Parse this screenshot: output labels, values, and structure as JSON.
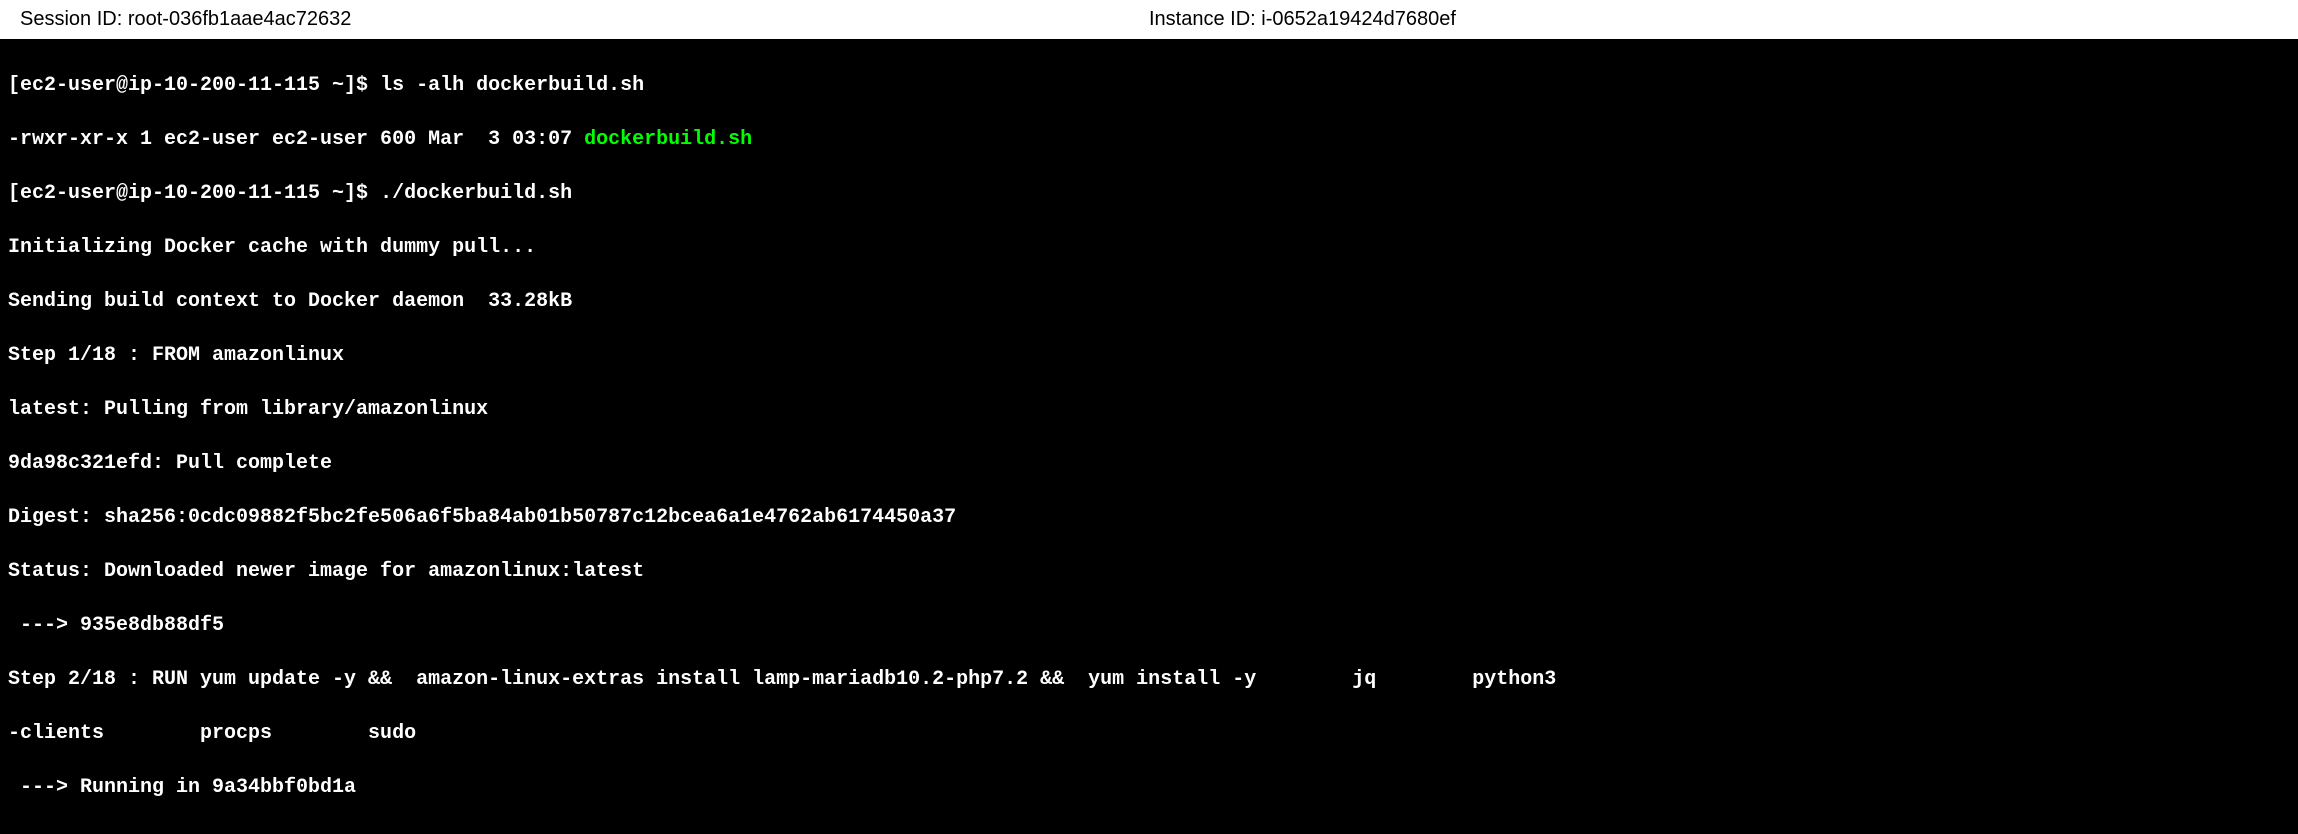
{
  "header": {
    "session_label": "Session ID: ",
    "session_id": "root-036fb1aae4ac72632",
    "instance_label": "Instance ID: ",
    "instance_id": "i-0652a19424d7680ef"
  },
  "terminal": {
    "line1_prompt": "[ec2-user@ip-10-200-11-115 ~]$ ",
    "line1_cmd": "ls -alh dockerbuild.sh",
    "line2_pre": "-rwxr-xr-x 1 ec2-user ec2-user 600 Mar  3 03:07 ",
    "line2_file": "dockerbuild.sh",
    "line3_prompt": "[ec2-user@ip-10-200-11-115 ~]$ ",
    "line3_cmd": "./dockerbuild.sh",
    "line4": "Initializing Docker cache with dummy pull...",
    "line5": "Sending build context to Docker daemon  33.28kB",
    "line6": "Step 1/18 : FROM amazonlinux",
    "line7": "latest: Pulling from library/amazonlinux",
    "line8": "9da98c321efd: Pull complete",
    "line9": "Digest: sha256:0cdc09882f5bc2fe506a6f5ba84ab01b50787c12bcea6a1e4762ab6174450a37",
    "line10": "Status: Downloaded newer image for amazonlinux:latest",
    "line11": " ---> 935e8db88df5",
    "line12": "Step 2/18 : RUN yum update -y &&  amazon-linux-extras install lamp-mariadb10.2-php7.2 &&  yum install -y        jq        python3",
    "line13": "-clients        procps        sudo",
    "line14": " ---> Running in 9a34bbf0bd1a"
  }
}
